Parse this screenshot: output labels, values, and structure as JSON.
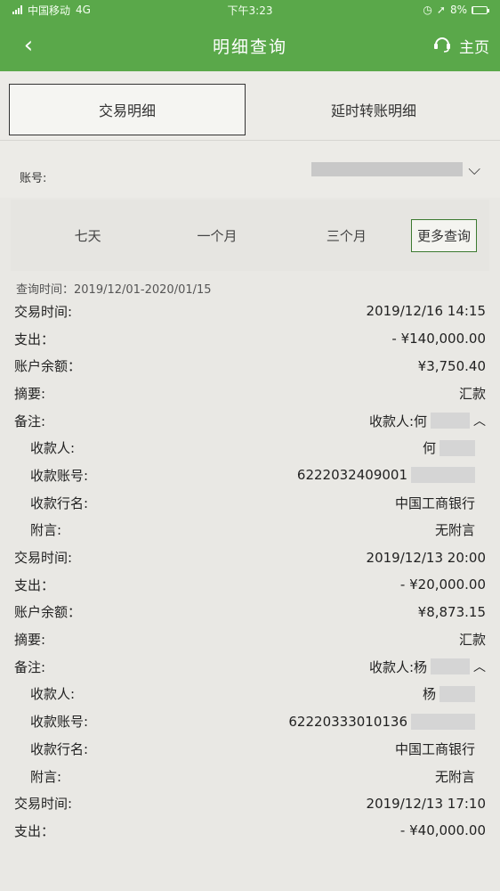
{
  "status_bar": {
    "carrier": "中国移动",
    "network": "4G",
    "time": "下午3:23",
    "battery": "8%"
  },
  "nav": {
    "title": "明细查询",
    "home_label": "主页"
  },
  "tabs": {
    "transaction": "交易明细",
    "delayed": "延时转账明细"
  },
  "account": {
    "label": "账号:"
  },
  "period": {
    "seven_days": "七天",
    "one_month": "一个月",
    "three_months": "三个月",
    "more": "更多查询"
  },
  "query_time": "查询时间：2019/12/01-2020/01/15",
  "labels": {
    "time": "交易时间:",
    "expense": "支出：",
    "balance": "账户余额：",
    "summary": "摘要:",
    "remark": "备注:",
    "payee": "收款人:",
    "payee_account": "收款账号:",
    "bank": "收款行名:",
    "message": "附言:"
  },
  "records": [
    {
      "time": "2019/12/16 14:15",
      "expense": "- ¥140,000.00",
      "balance": "¥3,750.40",
      "summary": "汇款",
      "remark": "收款人:何",
      "payee": "何",
      "payee_account": "6222032409001",
      "bank": "中国工商银行",
      "message": "无附言"
    },
    {
      "time": "2019/12/13 20:00",
      "expense": "- ¥20,000.00",
      "balance": "¥8,873.15",
      "summary": "汇款",
      "remark": "收款人:杨",
      "payee": "杨",
      "payee_account": "62220333010136",
      "bank": "中国工商银行",
      "message": "无附言"
    },
    {
      "time": "2019/12/13 17:10",
      "expense": "- ¥40,000.00"
    }
  ]
}
